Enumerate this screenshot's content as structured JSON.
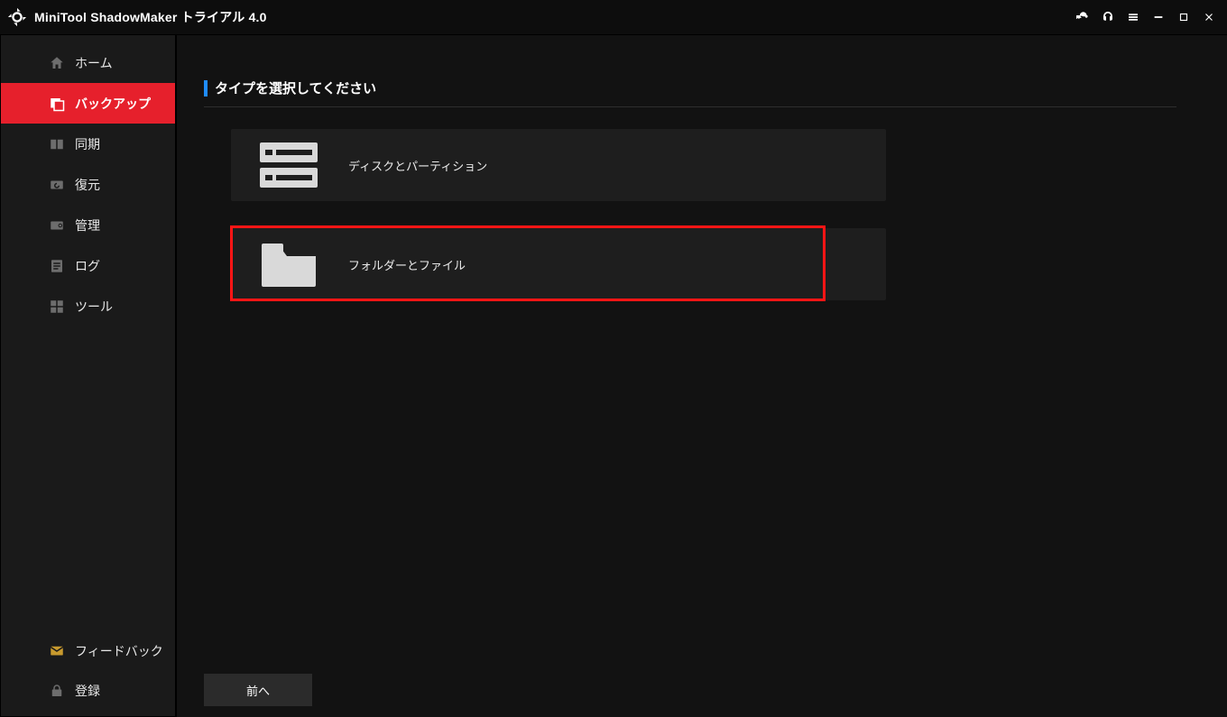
{
  "app": {
    "name": "MiniTool ShadowMaker",
    "trial_suffix": "トライアル 4.0"
  },
  "sidebar": {
    "items": [
      {
        "id": "home",
        "label": "ホーム",
        "active": false
      },
      {
        "id": "backup",
        "label": "バックアップ",
        "active": true
      },
      {
        "id": "sync",
        "label": "同期",
        "active": false
      },
      {
        "id": "restore",
        "label": "復元",
        "active": false
      },
      {
        "id": "manage",
        "label": "管理",
        "active": false
      },
      {
        "id": "log",
        "label": "ログ",
        "active": false
      },
      {
        "id": "tools",
        "label": "ツール",
        "active": false
      }
    ],
    "bottom": [
      {
        "id": "feedback",
        "label": "フィードバック"
      },
      {
        "id": "register",
        "label": "登録"
      }
    ]
  },
  "main": {
    "heading": "タイプを選択してください",
    "options": [
      {
        "id": "disk-partition",
        "label": "ディスクとパーティション"
      },
      {
        "id": "folders-files",
        "label": "フォルダーとファイル",
        "highlighted": true
      }
    ],
    "back_button": "前へ"
  },
  "colors": {
    "accent_red": "#e6202c",
    "accent_blue": "#1f8cff",
    "highlight": "#ff1515"
  }
}
